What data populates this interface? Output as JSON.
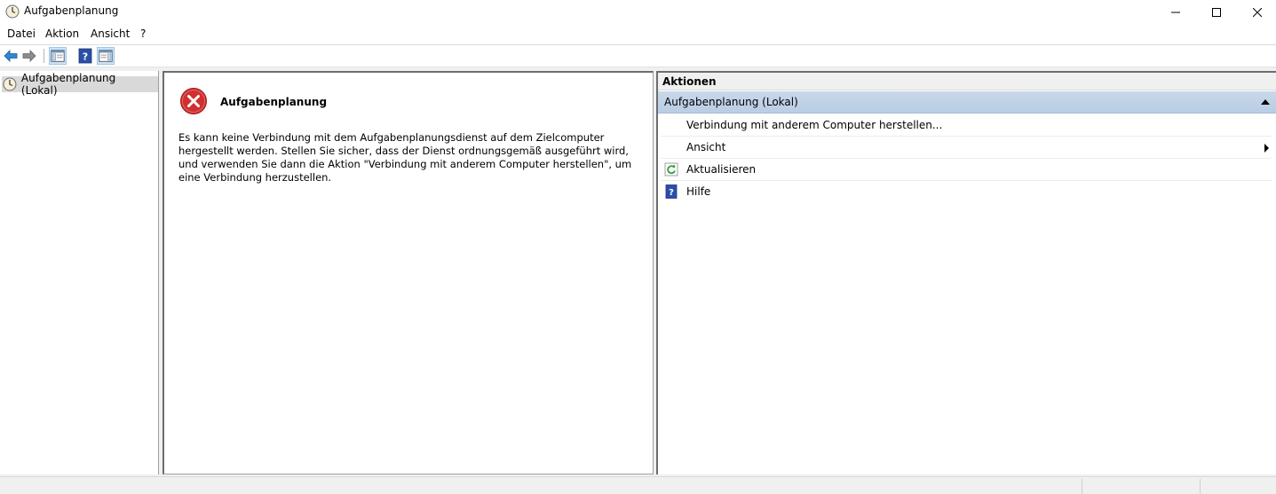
{
  "window": {
    "title": "Aufgabenplanung",
    "controls": [
      "minimize-icon",
      "maximize-icon",
      "close-icon"
    ]
  },
  "menu": {
    "items": [
      {
        "label": "Datei"
      },
      {
        "label": "Aktion"
      },
      {
        "label": "Ansicht"
      },
      {
        "label": "?"
      }
    ]
  },
  "toolbar": {
    "buttons": [
      "back-arrow-icon",
      "forward-arrow-icon",
      "show-hide-console-tree-icon",
      "help-icon",
      "show-hide-action-pane-icon"
    ]
  },
  "tree": {
    "root_label": "Aufgabenplanung (Lokal)"
  },
  "center": {
    "error_title": "Aufgabenplanung",
    "error_message": "Es kann keine Verbindung mit dem Aufgabenplanungsdienst auf dem Zielcomputer hergestellt werden. Stellen Sie sicher, dass der Dienst ordnungsgemäß ausgeführt wird, und verwenden Sie dann die Aktion \"Verbindung mit anderem Computer herstellen\", um eine Verbindung herzustellen."
  },
  "actions": {
    "header": "Aktionen",
    "group_label": "Aufgabenplanung (Lokal)",
    "items": [
      {
        "label": "Verbindung mit anderem Computer herstellen...",
        "icon": ""
      },
      {
        "label": "Ansicht",
        "icon": "",
        "submenu": true
      },
      {
        "label": "Aktualisieren",
        "icon": "refresh-icon"
      },
      {
        "label": "Hilfe",
        "icon": "help-icon"
      }
    ]
  },
  "colors": {
    "selection_group": "#c4d5ea",
    "error_red": "#d0302f",
    "help_blue": "#2b4fa8"
  }
}
